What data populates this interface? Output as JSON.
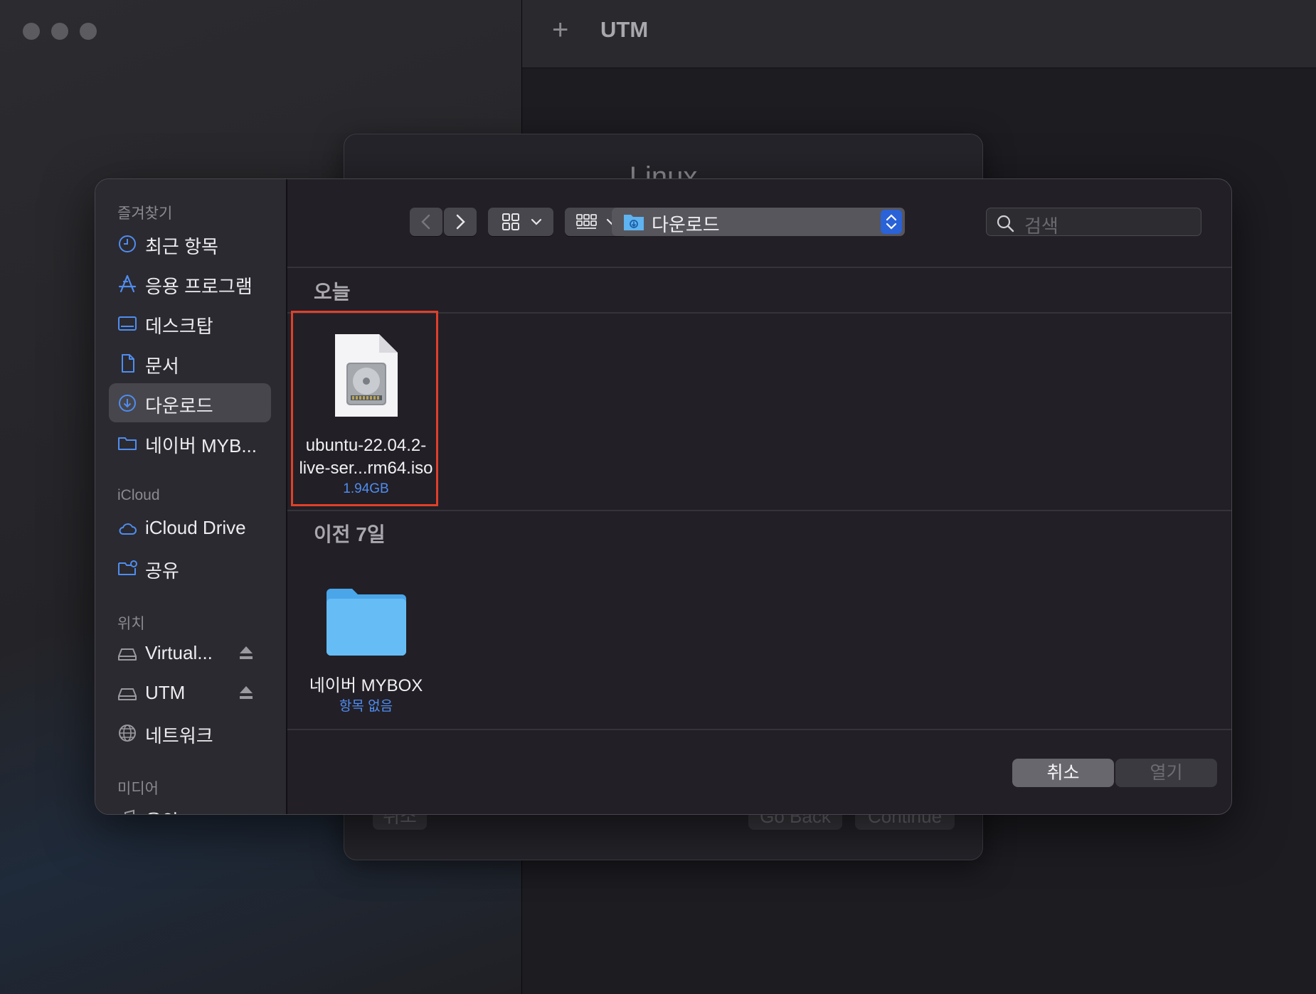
{
  "background_window": {
    "title": "UTM",
    "add_symbol": "+",
    "wizard": {
      "title": "Linux",
      "cancel_label": "취소",
      "go_back_label": "Go Back",
      "continue_label": "Continue"
    }
  },
  "sidebar": {
    "favorites_header": "즐겨찾기",
    "favorites": [
      {
        "label": "최근 항목",
        "icon": "clock-icon"
      },
      {
        "label": "응용 프로그램",
        "icon": "apps-icon"
      },
      {
        "label": "데스크탑",
        "icon": "desktop-icon"
      },
      {
        "label": "문서",
        "icon": "document-icon"
      },
      {
        "label": "다운로드",
        "icon": "download-icon",
        "selected": true
      },
      {
        "label": "네이버 MYB...",
        "icon": "folder-icon"
      }
    ],
    "icloud_header": "iCloud",
    "icloud": [
      {
        "label": "iCloud Drive",
        "icon": "cloud-icon"
      },
      {
        "label": "공유",
        "icon": "shared-folder-icon"
      }
    ],
    "locations_header": "위치",
    "locations": [
      {
        "label": "Virtual...",
        "icon": "drive-icon",
        "ejectable": true
      },
      {
        "label": "UTM",
        "icon": "drive-icon",
        "ejectable": true
      },
      {
        "label": "네트워크",
        "icon": "network-icon"
      }
    ],
    "media_header": "미디어",
    "media": [
      {
        "label": "음악",
        "icon": "music-icon"
      }
    ]
  },
  "toolbar": {
    "path": "다운로드",
    "search_placeholder": "검색"
  },
  "groups": [
    {
      "header": "오늘",
      "files": [
        {
          "name_line1": "ubuntu-22.04.2-",
          "name_line2": "live-ser...rm64.iso",
          "meta": "1.94GB",
          "icon": "disk-image-icon"
        }
      ]
    },
    {
      "header": "이전 7일",
      "files": [
        {
          "name_line1": "네이버 MYBOX",
          "meta": "항목 없음",
          "icon": "folder-icon"
        }
      ]
    }
  ],
  "buttons": {
    "cancel": "취소",
    "open": "열기"
  },
  "colors": {
    "accent": "#2a62d8",
    "sidebar_icon": "#4f8df0",
    "selection_outline": "#e0402a"
  }
}
